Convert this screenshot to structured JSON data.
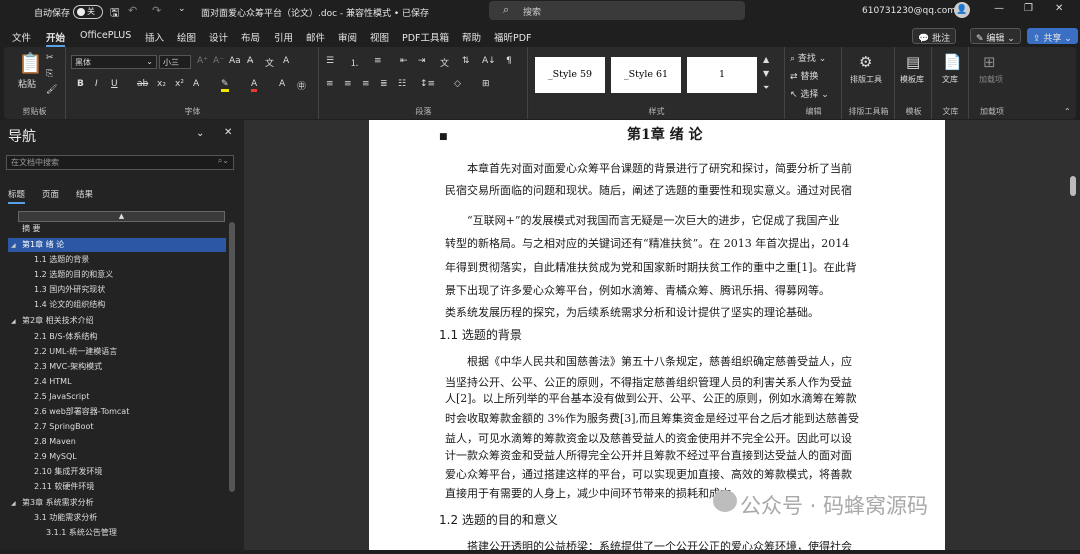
{
  "titlebar": {
    "autosave_label": "自动保存",
    "autosave_state": "关",
    "doc_title": "面对面爱心众筹平台（论文）.doc - 兼容性模式 • 已保存",
    "search_placeholder": "搜索",
    "account": "610731230@qq.com"
  },
  "tabs": [
    "文件",
    "开始",
    "OfficePLUS",
    "插入",
    "绘图",
    "设计",
    "布局",
    "引用",
    "邮件",
    "审阅",
    "视图",
    "PDF工具箱",
    "帮助",
    "福昕PDF"
  ],
  "right_buttons": {
    "comments": "批注",
    "edit": "编辑",
    "share": "共享"
  },
  "ribbon": {
    "clipboard": {
      "paste": "粘贴",
      "label": "剪贴板"
    },
    "font": {
      "name": "黑体",
      "size": "小三",
      "label": "字体"
    },
    "paragraph": {
      "label": "段落"
    },
    "styles": {
      "items": [
        "_Style 59",
        "_Style 61",
        "1"
      ],
      "label": "样式"
    },
    "editing": {
      "find": "查找",
      "replace": "替换",
      "select": "选择",
      "label": "编辑"
    },
    "layout_tool": {
      "label_top": "排版工具",
      "label": "排版工具箱"
    },
    "template": {
      "label_top": "模板库",
      "label": "模板"
    },
    "library": {
      "label_top": "文库",
      "label": "文库"
    },
    "addins": {
      "label_top": "加载项",
      "label": "加载项"
    }
  },
  "nav": {
    "title": "导航",
    "search_placeholder": "在文档中搜索",
    "tabs": [
      "标题",
      "页面",
      "结果"
    ],
    "items": [
      {
        "text": "摘 要",
        "level": 1
      },
      {
        "text": "第1章 绪 论",
        "level": 1,
        "selected": true
      },
      {
        "text": "1.1 选题的背景",
        "level": 2
      },
      {
        "text": "1.2 选题的目的和意义",
        "level": 2
      },
      {
        "text": "1.3 国内外研究现状",
        "level": 2
      },
      {
        "text": "1.4 论文的组织结构",
        "level": 2
      },
      {
        "text": "第2章 相关技术介绍",
        "level": 1
      },
      {
        "text": "2.1 B/S-体系结构",
        "level": 2
      },
      {
        "text": "2.2 UML-统一建模语言",
        "level": 2
      },
      {
        "text": "2.3 MVC-架构模式",
        "level": 2
      },
      {
        "text": "2.4 HTML",
        "level": 2
      },
      {
        "text": "2.5 JavaScript",
        "level": 2
      },
      {
        "text": "2.6 web部署容器-Tomcat",
        "level": 2
      },
      {
        "text": "2.7 SpringBoot",
        "level": 2
      },
      {
        "text": "2.8 Maven",
        "level": 2
      },
      {
        "text": "2.9 MySQL",
        "level": 2
      },
      {
        "text": "2.10 集成开发环境",
        "level": 2
      },
      {
        "text": "2.11 软硬件环境",
        "level": 2
      },
      {
        "text": "第3章 系统需求分析",
        "level": 1
      },
      {
        "text": "3.1 功能需求分析",
        "level": 2
      },
      {
        "text": "3.1.1 系统公告管理",
        "level": 3
      }
    ]
  },
  "document": {
    "chapter_title": "第1章  绪  论",
    "lines": [
      "本章首先对面对面爱心众筹平台课题的背景进行了研究和探讨，简要分析了当前",
      "民宿交易所面临的问题和现状。随后，阐述了选题的重要性和现实意义。通过对民宿",
      "“互联网+”的发展模式对我国而言无疑是一次巨大的进步，它促成了我国产业",
      "转型的新格局。与之相对应的关键词还有“精准扶贫”。在 2013 年首次提出，2014",
      "年得到贯彻落实，自此精准扶贫成为党和国家新时期扶贫工作的重中之重[1]。在此背",
      "景下出现了许多爱心众筹平台，例如水滴筹、青橘众筹、腾讯乐捐、得募网等。",
      "类系统发展历程的探究，为后续系统需求分析和设计提供了坚实的理论基础。",
      "根据《中华人民共和国慈善法》第五十八条规定，慈善组织确定慈善受益人，应",
      "当坚持公开、公平、公正的原则，不得指定慈善组织管理人员的利害关系人作为受益",
      "人[2]。以上所列举的平台基本没有做到公开、公平、公正的原则，例如水滴筹在筹款",
      "时会收取筹款金额的 3%作为服务费[3],而且筹集资金是经过平台之后才能到达慈善受",
      "益人，可见水滴筹的筹款资金以及慈善受益人的资金使用并不完全公开。因此可以设",
      "计一款众筹资金和受益人所得完全公开并且筹款不经过平台直接到达受益人的面对面",
      "爱心众筹平台，通过搭建这样的平台，可以实现更加直接、高效的筹款模式，将善款",
      "直接用于有需要的人身上，减少中间环节带来的损耗和成本。",
      "搭建公开透明的公益桥梁：系统提供了一个公开公正的爱心众筹环境，使得社会"
    ],
    "heading_1_1": "1.1   选题的背景",
    "heading_1_2": "1.2   选题的目的和意义"
  },
  "watermark": "公众号 · 码蜂窝源码"
}
